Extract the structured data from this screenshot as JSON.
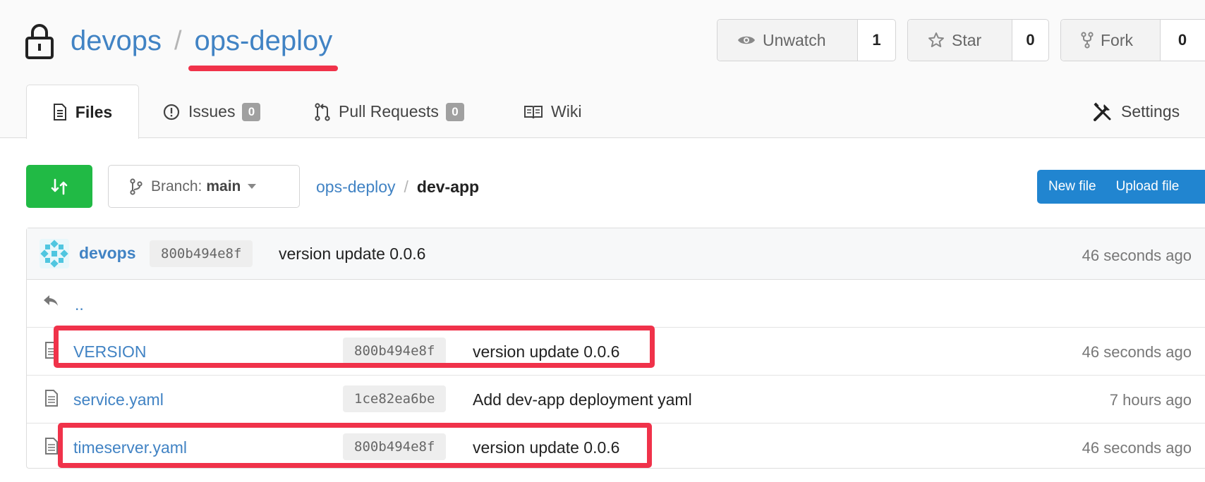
{
  "repo": {
    "owner": "devops",
    "separator": "/",
    "name": "ops-deploy"
  },
  "actions": {
    "watch": {
      "label": "Unwatch",
      "count": "1"
    },
    "star": {
      "label": "Star",
      "count": "0"
    },
    "fork": {
      "label": "Fork",
      "count": "0"
    }
  },
  "tabs": {
    "files": "Files",
    "issues": {
      "label": "Issues",
      "count": "0"
    },
    "pulls": {
      "label": "Pull Requests",
      "count": "0"
    },
    "wiki": "Wiki",
    "settings": "Settings"
  },
  "toolbar": {
    "branch_prefix": "Branch:",
    "branch_value": "main",
    "path_root": "ops-deploy",
    "path_sep": "/",
    "path_current": "dev-app",
    "new_file": "New file",
    "upload_file": "Upload file"
  },
  "latest_commit": {
    "author": "devops",
    "sha": "800b494e8f",
    "message": "version update 0.0.6",
    "when": "46 seconds ago"
  },
  "parent_dir": "..",
  "files": [
    {
      "name": "VERSION",
      "sha": "800b494e8f",
      "message": "version update 0.0.6",
      "when": "46 seconds ago"
    },
    {
      "name": "service.yaml",
      "sha": "1ce82ea6be",
      "message": "Add dev-app deployment yaml",
      "when": "7 hours ago"
    },
    {
      "name": "timeserver.yaml",
      "sha": "800b494e8f",
      "message": "version update 0.0.6",
      "when": "46 seconds ago"
    }
  ],
  "colors": {
    "link": "#4183c4",
    "accent_green": "#21ba45",
    "accent_blue": "#2185d0",
    "annotation_red": "#f0324a"
  }
}
